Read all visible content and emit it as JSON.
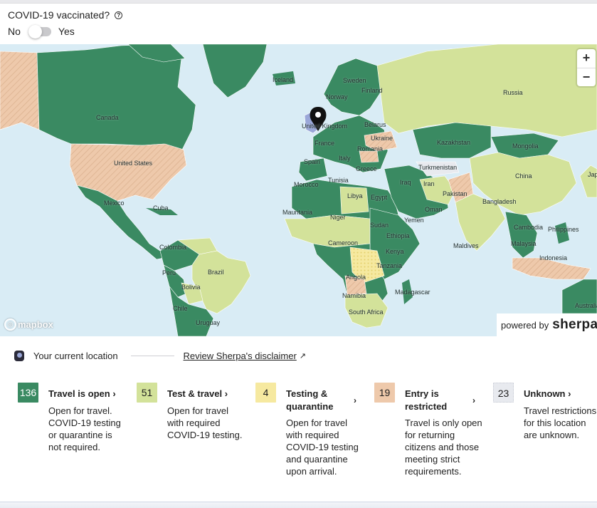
{
  "vaccination": {
    "question": "COVID-19 vaccinated?",
    "help_icon": "help-circle-icon",
    "no_label": "No",
    "yes_label": "Yes",
    "selected": "No"
  },
  "map": {
    "zoom_in": "+",
    "zoom_out": "−",
    "attribution_logo": "mapbox",
    "powered_by": "powered by",
    "brand": "sherpa°",
    "colors": {
      "ocean": "#d9ecf5",
      "open": "#3a8a62",
      "test": "#d3e29a",
      "quarantine": "#f6e9a0",
      "restricted": "#eec9ab",
      "unknown": "#e8eaef",
      "current_location": "#9aa7d8"
    },
    "labels": [
      "Canada",
      "United States",
      "Mexico",
      "Cuba",
      "Colombia",
      "Peru",
      "Brazil",
      "Bolivia",
      "Chile",
      "Uruguay",
      "Iceland",
      "Sweden",
      "Norway",
      "Finland",
      "United Kingdom",
      "France",
      "Spain",
      "Italy",
      "Belarus",
      "Ukraine",
      "Romania",
      "Greece",
      "Morocco",
      "Tunisia",
      "Libya",
      "Egypt",
      "Mauritania",
      "Niger",
      "Sudan",
      "Ethiopia",
      "Yemen",
      "Oman",
      "Cameroon",
      "Kenya",
      "Tanzania",
      "Angola",
      "Namibia",
      "South Africa",
      "Madagascar",
      "Iraq",
      "Iran",
      "Turkmenistan",
      "Pakistan",
      "Kazakhstan",
      "Mongolia",
      "Russia",
      "China",
      "Bangladesh",
      "Maldives",
      "Cambodia",
      "Philippines",
      "Malaysia",
      "Indonesia",
      "Japan",
      "Australia"
    ]
  },
  "location_row": {
    "current_location": "Your current location",
    "disclaimer": "Review Sherpa's disclaimer",
    "external_icon": "external-link-icon"
  },
  "legend": [
    {
      "count": "136",
      "title": "Travel is open",
      "description": [
        "Open for travel.",
        "COVID-19 testing",
        "or quarantine is",
        "not required."
      ],
      "color": "#3a8a62",
      "text_color": "#ffffff"
    },
    {
      "count": "51",
      "title": "Test & travel",
      "description": [
        "Open for travel",
        "with required",
        "COVID-19 testing."
      ],
      "color": "#d3e29a",
      "text_color": "#1f1f1f"
    },
    {
      "count": "4",
      "title_lines": [
        "Testing &",
        "quarantine"
      ],
      "description": [
        "Open for travel",
        "with required",
        "COVID-19 testing",
        "and quarantine",
        "upon arrival."
      ],
      "color": "#f6e9a0",
      "text_color": "#1f1f1f"
    },
    {
      "count": "19",
      "title_lines": [
        "Entry is",
        "restricted"
      ],
      "description": [
        "Travel is only open",
        "for returning",
        "citizens and those",
        "meeting strict",
        "requirements."
      ],
      "color": "#eec9ab",
      "text_color": "#1f1f1f"
    },
    {
      "count": "23",
      "title": "Unknown",
      "description": [
        "Travel restrictions",
        "for this location",
        "are unknown."
      ],
      "color": "#e8eaef",
      "text_color": "#1f1f1f"
    }
  ]
}
